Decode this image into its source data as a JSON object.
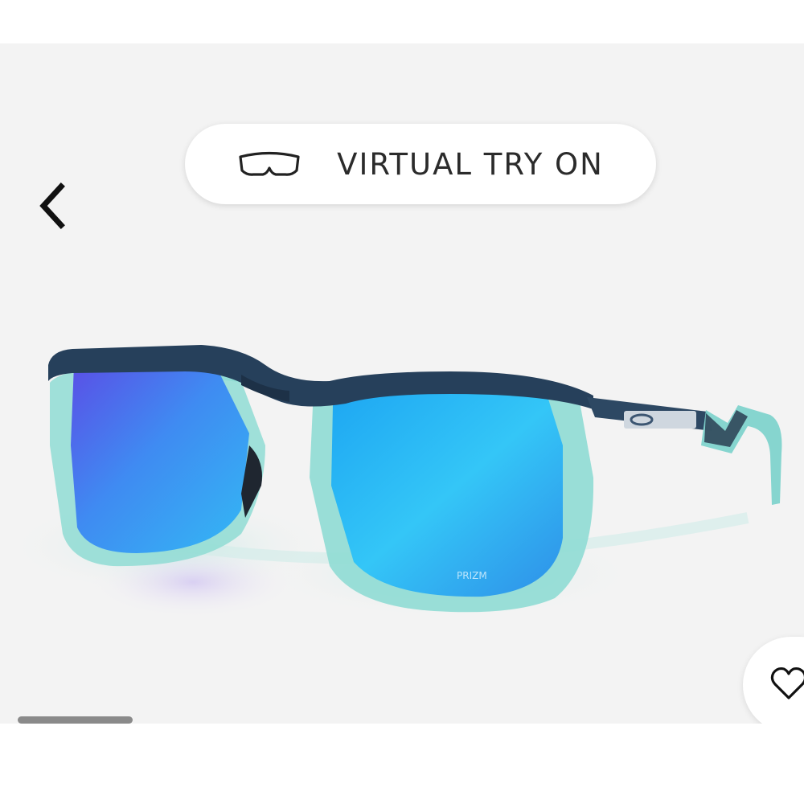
{
  "try_on": {
    "label": "VIRTUAL TRY ON",
    "icon": "glasses-outline-icon"
  },
  "navigation": {
    "back_icon": "chevron-left-icon"
  },
  "product": {
    "image_icon": "sunglasses-product-image",
    "lens_text": "PRIZM"
  },
  "favorite": {
    "icon": "heart-outline-icon"
  },
  "carousel": {
    "progress": 0.15
  },
  "colors": {
    "gallery_background": "#f3f3f3",
    "frame_top": "#27405a",
    "frame_clear": "#7fd3cc",
    "lens_blue": "#1fb3ee",
    "lens_violet": "#6d57e8",
    "scroll_thumb": "#8a8a8a"
  }
}
